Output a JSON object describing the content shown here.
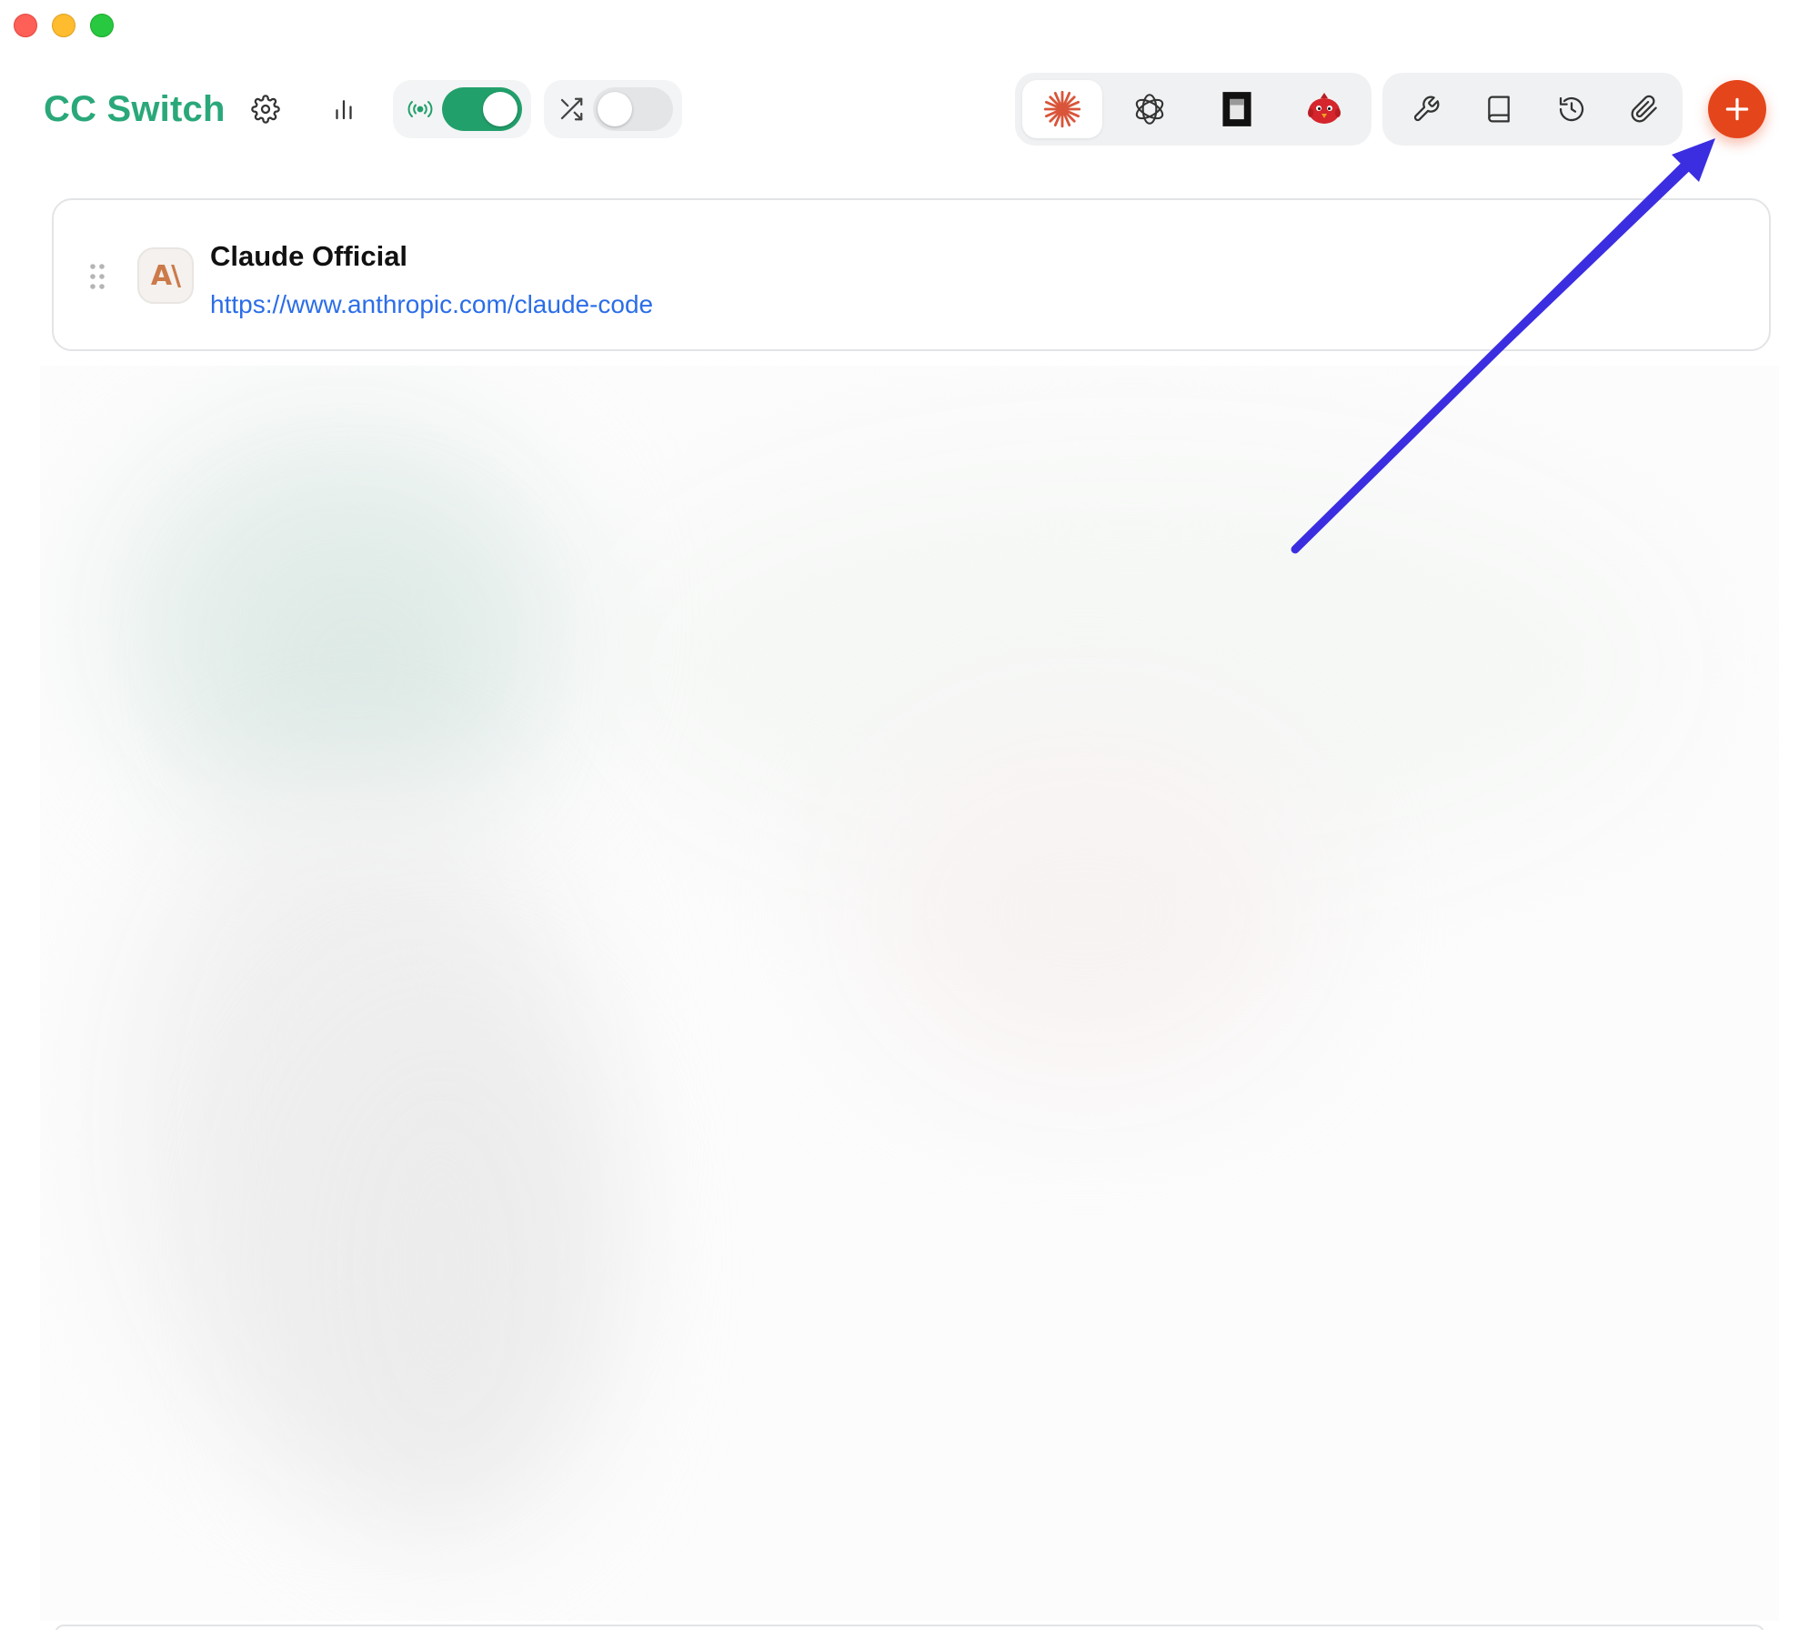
{
  "app": {
    "title": "CC Switch"
  },
  "toolbar": {
    "proxy_toggle_on": true,
    "shuffle_toggle_on": false
  },
  "app_switcher": {
    "tabs": [
      {
        "name": "claude",
        "icon": "claude-starburst-icon",
        "active": true
      },
      {
        "name": "codex",
        "icon": "openai-icon",
        "active": false
      },
      {
        "name": "gemini",
        "icon": "terminal-square-icon",
        "active": false
      },
      {
        "name": "other",
        "icon": "red-bird-icon",
        "active": false
      }
    ]
  },
  "tools": {
    "items": [
      {
        "icon": "wrench-icon"
      },
      {
        "icon": "book-icon"
      },
      {
        "icon": "history-icon"
      },
      {
        "icon": "paperclip-icon"
      }
    ]
  },
  "providers": [
    {
      "logo_text": "A\\",
      "name": "Claude Official",
      "url": "https://www.anthropic.com/claude-code"
    }
  ],
  "colors": {
    "brand": "#2aa87a",
    "toggle_on": "#22a06b",
    "add_button": "#e5451b",
    "link": "#2b6de8",
    "annotation_arrow": "#3b2ee0"
  }
}
